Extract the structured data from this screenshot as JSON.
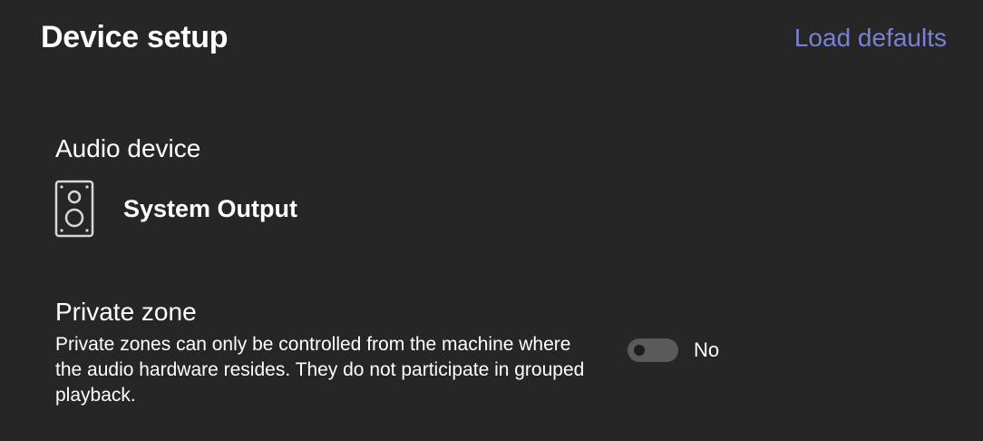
{
  "header": {
    "title": "Device setup",
    "load_defaults_label": "Load defaults"
  },
  "audio_device": {
    "label": "Audio device",
    "icon": "speaker-icon",
    "name": "System Output"
  },
  "private_zone": {
    "label": "Private zone",
    "description": "Private zones can only be controlled from the machine where the audio hardware resides. They do not participate in grouped playback.",
    "enabled": false,
    "state_label": "No"
  },
  "colors": {
    "background": "#262626",
    "accent_link": "#7b7fd6",
    "toggle_off": "#5a5a5a"
  }
}
